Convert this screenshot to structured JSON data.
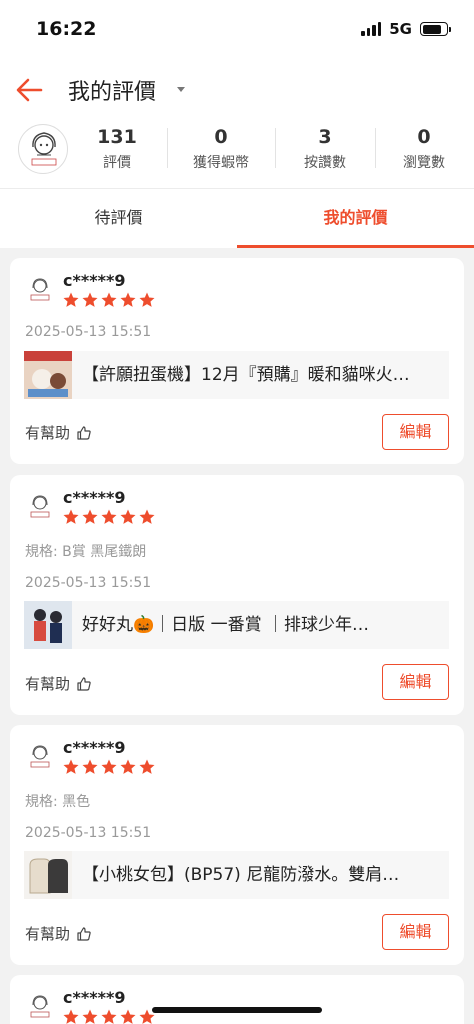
{
  "status_bar": {
    "time": "16:22",
    "network": "5G"
  },
  "header": {
    "title": "我的評價"
  },
  "stats": [
    {
      "value": "131",
      "label": "評價"
    },
    {
      "value": "0",
      "label": "獲得蝦幣"
    },
    {
      "value": "3",
      "label": "按讚數"
    },
    {
      "value": "0",
      "label": "瀏覽數"
    }
  ],
  "tabs": [
    {
      "label": "待評價",
      "active": false
    },
    {
      "label": "我的評價",
      "active": true
    }
  ],
  "reviews": [
    {
      "username": "c*****9",
      "rating": 5,
      "spec": "",
      "date": "2025-05-13 15:51",
      "product": "【許願扭蛋機】12月『預購』暖和貓咪火…",
      "helpful": "有幫助",
      "edit": "編輯"
    },
    {
      "username": "c*****9",
      "rating": 5,
      "spec": "規格: B賞 黑尾鐵朗",
      "date": "2025-05-13 15:51",
      "product": "好好丸🎃｜日版 一番賞 ｜排球少年…",
      "helpful": "有幫助",
      "edit": "編輯"
    },
    {
      "username": "c*****9",
      "rating": 5,
      "spec": "規格: 黑色",
      "date": "2025-05-13 15:51",
      "product": "【小桃女包】(BP57) 尼龍防潑水。雙肩…",
      "helpful": "有幫助",
      "edit": "編輯"
    },
    {
      "username": "c*****9",
      "rating": 5
    }
  ],
  "colors": {
    "accent": "#ee4d2d",
    "star": "#ee4d2d",
    "background": "#f2f2f2"
  }
}
